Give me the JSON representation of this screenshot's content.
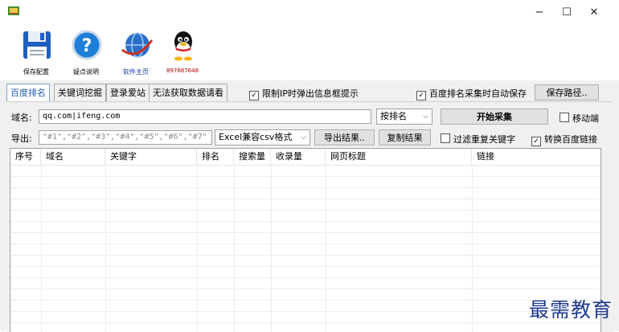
{
  "window": {
    "minimize": "−",
    "maximize": "☐",
    "close": "✕"
  },
  "toolbar": {
    "save_config": "保存配置",
    "faq": "疑点说明",
    "homepage": "软件主页",
    "qq_number": "897687648"
  },
  "tabs": [
    {
      "label": "百度排名",
      "active": true
    },
    {
      "label": "关键词挖掘",
      "active": false
    },
    {
      "label": "登录爱站",
      "active": false
    },
    {
      "label": "无法获取数据请看",
      "active": false
    }
  ],
  "options": {
    "limit_ip_popup": {
      "label": "限制IP时弹出信息框提示",
      "checked": true
    },
    "auto_save": {
      "label": "百度排名采集时自动保存",
      "checked": true
    },
    "save_path_button": "保存路径.."
  },
  "domain_row": {
    "label": "域名:",
    "value": "qq.com|ifeng.com",
    "sort_select": "按排名",
    "start_button": "开始采集",
    "move_checkbox": {
      "label": "移动端",
      "checked": false
    }
  },
  "export_row": {
    "label": "导出:",
    "format_placeholder": "\"#1\",\"#2\",\"#3\",\"#4\",\"#5\",\"#6\",\"#7\"",
    "format_select": "Excel兼容csv格式",
    "export_button": "导出结果..",
    "copy_button": "复制结果",
    "filter_dup": {
      "label": "过滤重复关键字",
      "checked": false
    },
    "convert_link": {
      "label": "转换百度链接",
      "checked": true
    }
  },
  "table": {
    "columns": [
      "序号",
      "域名",
      "关键字",
      "排名",
      "搜索量",
      "收录量",
      "网页标题",
      "链接"
    ]
  },
  "watermark": "最需教育",
  "colors": {
    "tab_active": "#1e5eb4",
    "qq_text": "#b40000",
    "homepage_text": "#1a3ca8"
  }
}
